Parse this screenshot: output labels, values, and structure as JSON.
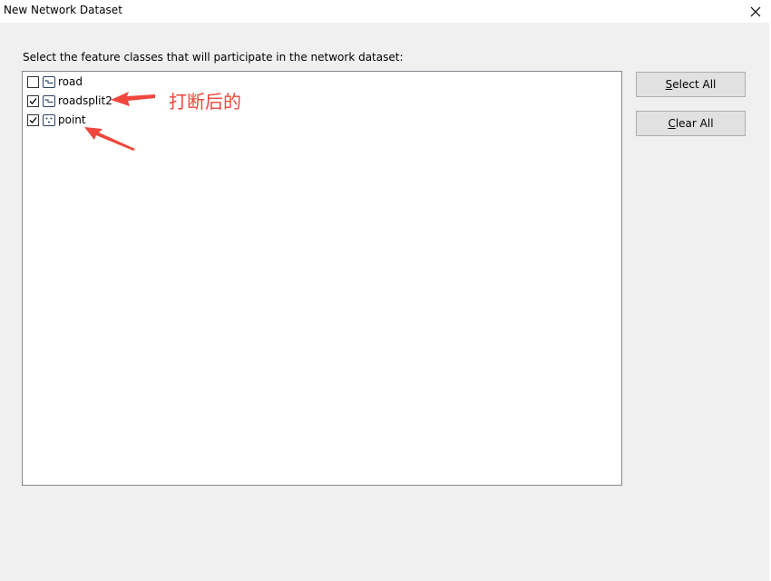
{
  "window": {
    "title": "New Network Dataset",
    "close_icon": "close-icon"
  },
  "instruction": "Select the feature classes that will participate in the network dataset:",
  "feature_classes": [
    {
      "label": "road",
      "checked": false,
      "icon": "line-feature-class-icon"
    },
    {
      "label": "roadsplit2",
      "checked": true,
      "icon": "line-feature-class-icon"
    },
    {
      "label": "point",
      "checked": true,
      "icon": "point-feature-class-icon"
    }
  ],
  "buttons": {
    "select_all": {
      "mnemonic": "S",
      "rest": "elect All"
    },
    "clear_all": {
      "mnemonic": "C",
      "rest": "lear All"
    }
  },
  "annotation": {
    "text": "打断后的",
    "color": "#f0463c"
  }
}
